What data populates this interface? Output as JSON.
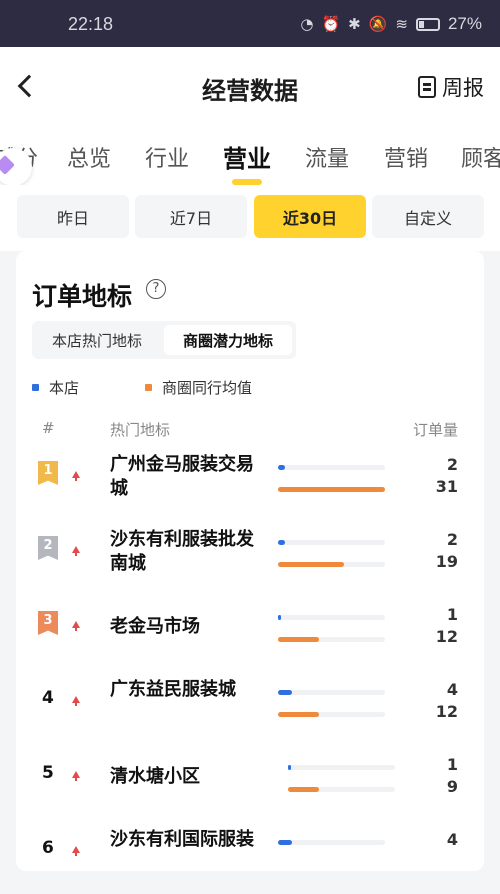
{
  "status_bar": {
    "time": "22:18",
    "battery": "27%"
  },
  "header": {
    "title": "经营数据",
    "weekly_label": "周报"
  },
  "tabs": [
    "辅分",
    "总览",
    "行业",
    "营业",
    "流量",
    "营销",
    "顾客"
  ],
  "active_tab": "营业",
  "date_filters": [
    "昨日",
    "近7日",
    "近30日",
    "自定义"
  ],
  "active_filter": "近30日",
  "card": {
    "title": "订单地标",
    "help_symbol": "?",
    "segments": [
      "本店热门地标",
      "商圈潜力地标"
    ],
    "active_segment": "商圈潜力地标",
    "legend": [
      {
        "label": "本店",
        "color": "#2f6fe0"
      },
      {
        "label": "商圈同行均值",
        "color": "#ef8a3c"
      }
    ],
    "headers": {
      "rank": "#",
      "name": "热门地标",
      "value": "订单量"
    },
    "rows": [
      {
        "rank": "1",
        "name": "广州金马服装交易城",
        "store": 2,
        "avg": 31
      },
      {
        "rank": "2",
        "name": "沙东有利服装批发南城",
        "store": 2,
        "avg": 19
      },
      {
        "rank": "3",
        "name": "老金马市场",
        "store": 1,
        "avg": 12
      },
      {
        "rank": "4",
        "name": "广东益民服装城",
        "store": 4,
        "avg": 12
      },
      {
        "rank": "5",
        "name": "清水塘小区",
        "store": 1,
        "avg": 9
      },
      {
        "rank": "6",
        "name": "沙东有利国际服装",
        "store": 4,
        "avg": null
      }
    ],
    "max_value": 31
  },
  "colors": {
    "accent": "#ffd22e",
    "store": "#2f6fe0",
    "avg": "#ef8a3c",
    "gold": "#f0b94a",
    "silver": "#b4b7bd",
    "bronze": "#ec8a5c"
  }
}
